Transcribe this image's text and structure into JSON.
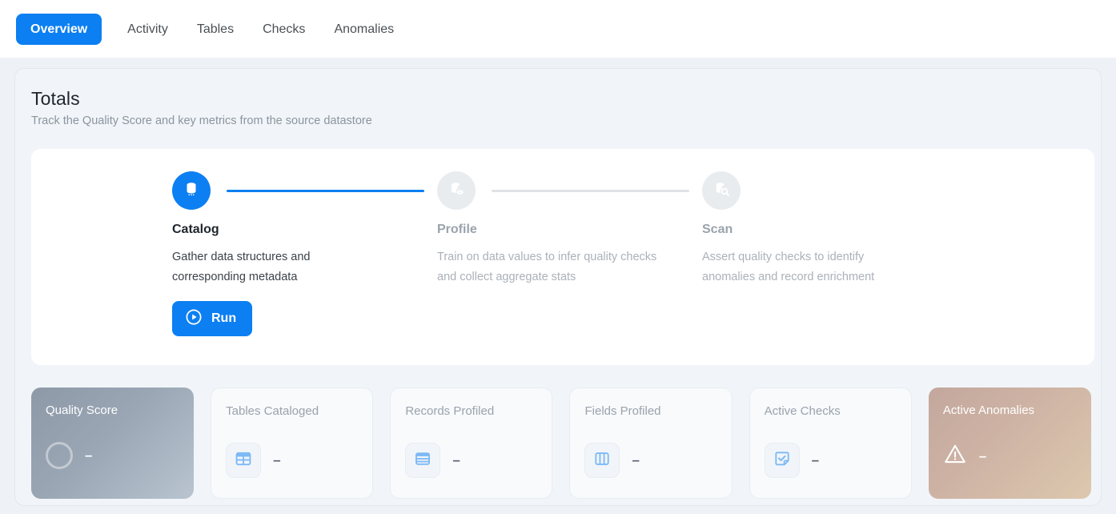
{
  "tabs": [
    {
      "label": "Overview",
      "active": true
    },
    {
      "label": "Activity",
      "active": false
    },
    {
      "label": "Tables",
      "active": false
    },
    {
      "label": "Checks",
      "active": false
    },
    {
      "label": "Anomalies",
      "active": false
    }
  ],
  "panel": {
    "title": "Totals",
    "subtitle": "Track the Quality Score and key metrics from the source datastore"
  },
  "stepper": {
    "steps": [
      {
        "name": "Catalog",
        "description": "Gather data structures and corresponding metadata",
        "icon": "database-icon",
        "state": "active"
      },
      {
        "name": "Profile",
        "description": "Train on data values to infer quality checks and collect aggregate stats",
        "icon": "database-eye-icon",
        "state": "inactive"
      },
      {
        "name": "Scan",
        "description": "Assert quality checks to identify anomalies and record enrichment",
        "icon": "database-search-icon",
        "state": "inactive"
      }
    ],
    "run_button": {
      "label": "Run",
      "icon": "play-circle-icon"
    }
  },
  "metrics": [
    {
      "label": "Quality Score",
      "value": "–",
      "icon": "progress-ring-icon",
      "style": "dark"
    },
    {
      "label": "Tables Cataloged",
      "value": "–",
      "icon": "table-icon",
      "style": "plain"
    },
    {
      "label": "Records Profiled",
      "value": "–",
      "icon": "rows-icon",
      "style": "plain"
    },
    {
      "label": "Fields Profiled",
      "value": "–",
      "icon": "columns-icon",
      "style": "plain"
    },
    {
      "label": "Active Checks",
      "value": "–",
      "icon": "check-square-icon",
      "style": "plain"
    },
    {
      "label": "Active Anomalies",
      "value": "–",
      "icon": "warning-triangle-icon",
      "style": "warm"
    }
  ],
  "colors": {
    "accent": "#0c7ff2",
    "page_background": "#eef2f6",
    "panel_background": "#f1f5f9",
    "card_background": "#ffffff",
    "icon_blue": "#7cb9f5",
    "muted_text": "#9aa3ac",
    "quality_card_gradient_start": "#8e99a8",
    "quality_card_gradient_end": "#b9c4d0",
    "anomaly_card_gradient_start": "#c3a79d",
    "anomaly_card_gradient_end": "#ddc8ae"
  }
}
